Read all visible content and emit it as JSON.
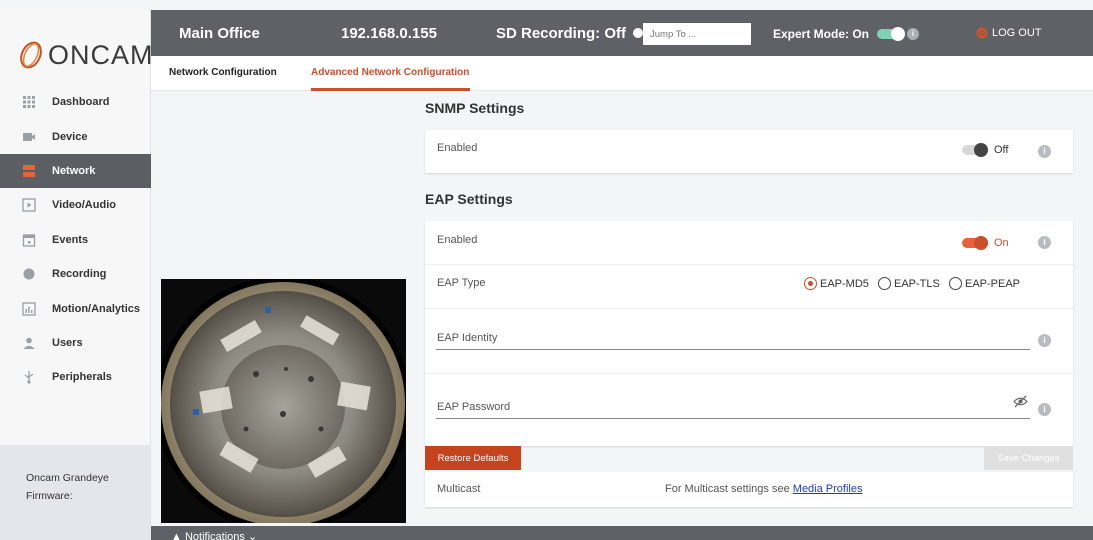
{
  "brand": {
    "logo_text": "ONCAM"
  },
  "sidebar": {
    "items": [
      {
        "label": "Dashboard",
        "icon": "grid-icon"
      },
      {
        "label": "Device",
        "icon": "camera-icon"
      },
      {
        "label": "Network",
        "icon": "network-icon"
      },
      {
        "label": "Video/Audio",
        "icon": "play-icon"
      },
      {
        "label": "Events",
        "icon": "calendar-icon"
      },
      {
        "label": "Recording",
        "icon": "record-icon"
      },
      {
        "label": "Motion/Analytics",
        "icon": "chart-icon"
      },
      {
        "label": "Users",
        "icon": "user-icon"
      },
      {
        "label": "Peripherals",
        "icon": "usb-icon"
      }
    ],
    "active_index": 2,
    "firmware_label_1": "Oncam Grandeye",
    "firmware_label_2": "Firmware:"
  },
  "header": {
    "location": "Main Office",
    "ip": "192.168.0.155",
    "sd_recording": "SD Recording: Off",
    "jump_placeholder": "Jump To ...",
    "expert_mode": "Expert Mode: On",
    "logout": "LOG OUT"
  },
  "tabs": [
    {
      "label": "Network Configuration"
    },
    {
      "label": "Advanced Network Configuration"
    }
  ],
  "snmp": {
    "title": "SNMP Settings",
    "enabled_label": "Enabled",
    "state": "Off"
  },
  "eap": {
    "title": "EAP Settings",
    "enabled_label": "Enabled",
    "state": "On",
    "type_label": "EAP Type",
    "options": [
      "EAP-MD5",
      "EAP-TLS",
      "EAP-PEAP"
    ],
    "selected": "EAP-MD5",
    "identity_label": "EAP Identity",
    "password_label": "EAP Password"
  },
  "buttons": {
    "restore": "Restore Defaults",
    "save": "Save Changes"
  },
  "multicast": {
    "label": "Multicast",
    "text": "For Multicast settings see",
    "link": "Media Profiles"
  },
  "footer": {
    "notifications": "Notifications"
  },
  "colors": {
    "accent": "#c8502a",
    "topbar": "#5e6267",
    "sidebar_active": "#5b5f64"
  }
}
